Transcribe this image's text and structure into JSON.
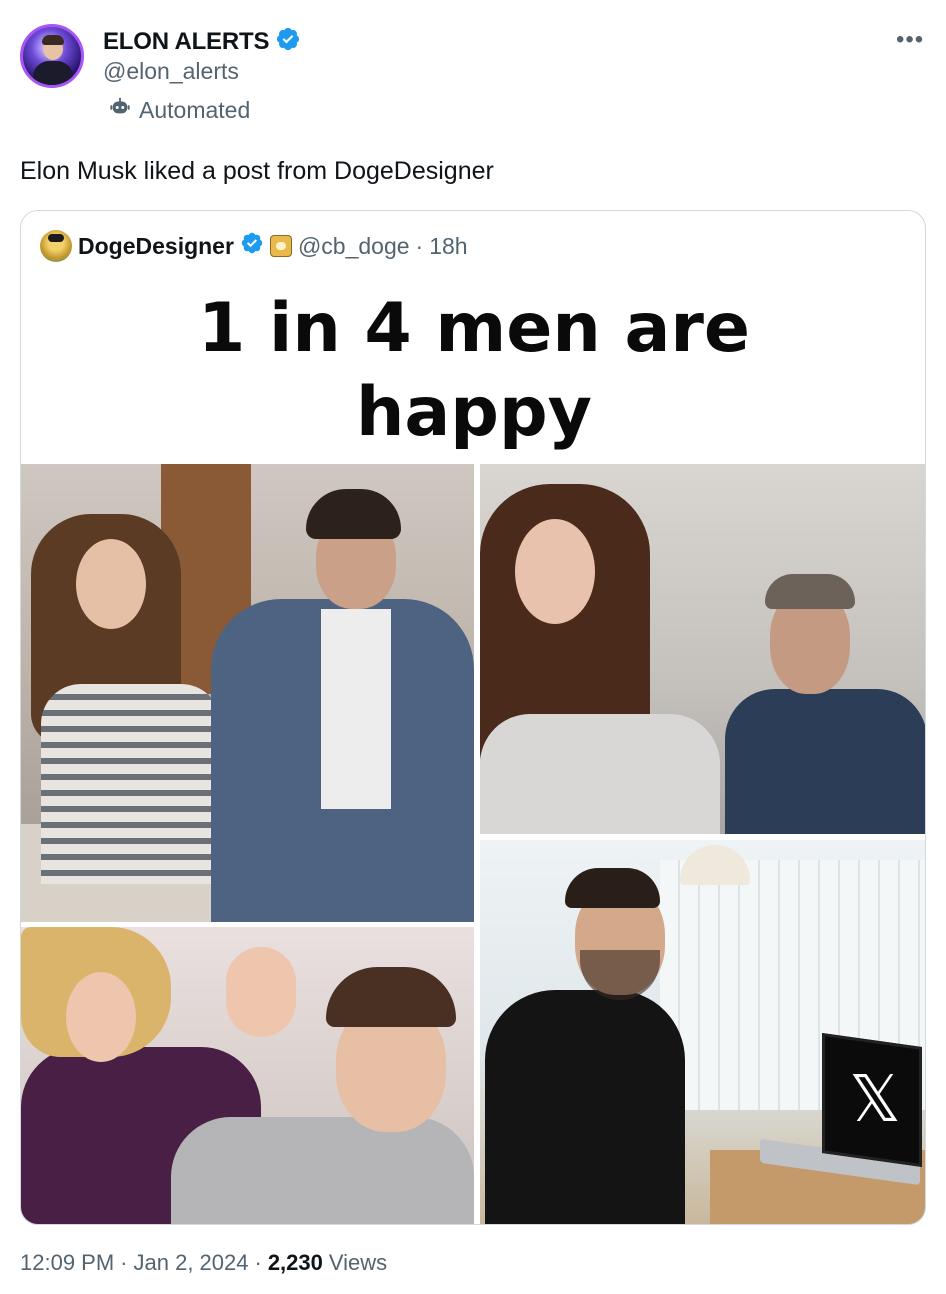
{
  "tweet": {
    "display_name": "ELON ALERTS",
    "handle": "@elon_alerts",
    "automated_label": "Automated",
    "more_label": "•••",
    "text": "Elon Musk liked a post from DogeDesigner"
  },
  "quote": {
    "display_name": "DogeDesigner",
    "handle": "@cb_doge",
    "separator": "·",
    "time": "18h",
    "image_caption": "1 in 4 men are\nhappy"
  },
  "footer": {
    "time": "12:09 PM",
    "sep1": "·",
    "date": "Jan 2, 2024",
    "sep2": "·",
    "views_count": "2,230",
    "views_label": "Views"
  },
  "colors": {
    "verified_blue": "#1d9bf0",
    "secondary_text": "#536471",
    "border": "#cfd9de"
  },
  "icons": {
    "verified": "verified-badge-icon",
    "automated": "bot-icon",
    "more": "more-options-icon"
  }
}
